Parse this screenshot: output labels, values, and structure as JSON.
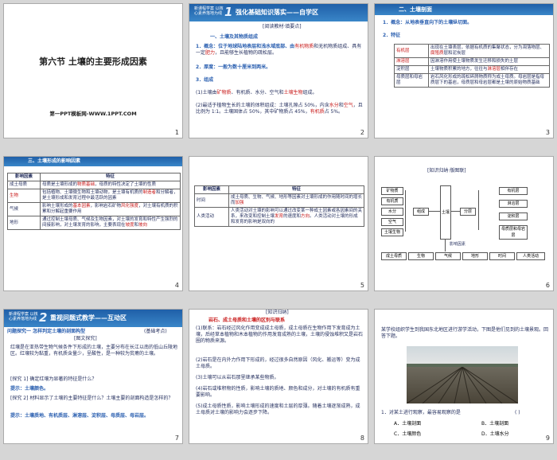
{
  "s1": {
    "title": "第六节  土壤的主要形成因素",
    "sub": "第一PPT模板网-WWW.1PPT.COM",
    "num": "1"
  },
  "s2": {
    "tag": "新课程学案 以核心素养落地为线",
    "big": "1",
    "title": "强化基础知识落实——自学区",
    "pink": "[阅读教材·填要点]",
    "h1": "一、土壤及其物质组成",
    "p1": "1．概念：位于地球陆地表层和浅水域底部、由",
    "p1a": "有机物质",
    "p1b": "和无机物质组成、具有一定",
    "p1c": "肥力",
    "p1d": "，且能够生长植物的疏松层。",
    "p2": "2．厚度：一般为数十厘米到两米。",
    "p3": "3．组成",
    "p4": "(1)土壤由",
    "p4a": "矿物质",
    "p4b": "、有机质、水分、空气和",
    "p4c": "土壤生物",
    "p4d": "组成。",
    "p5": "(2)最适于植物生长的土壤的体积组成：土壤孔隙占 50%，内含",
    "p5a": "水分",
    "p5b": "和",
    "p5c": "空气",
    "p5d": "，且比例为 1∶1。土壤固体占 50%，其中矿物质占 45%，",
    "p5e": "有机质",
    "p5f": "占 5%。",
    "num": "2"
  },
  "s3": {
    "title": "二、土壤剖面",
    "p1": "1．概念：从地表垂直向下的土壤纵切面。",
    "p2": "2．特征",
    "rows": [
      {
        "k": "有机层",
        "v": "出现在土壤表层，依据有机质的集聚状态，分为凋落物层、",
        "b": "腐殖质",
        "c": "层和泥炭层"
      },
      {
        "k": "淋溶层",
        "v": "因淋溶作用使土壤物质发生迁移和损失的土层",
        "b": "",
        "c": ""
      },
      {
        "k": "淀积层",
        "v": "土壤物质积累的地方，往往与",
        "b": "淋溶层",
        "c": "相伴存在"
      },
      {
        "k": "母质层和母岩层",
        "v": "岩石风化形成的疏松碎屑物质称为成土母质。",
        "b": "",
        "c": "母岩层是指母质层下的基岩，母质层和母岩层都是土壤的原始物质基础"
      }
    ],
    "num": "3"
  },
  "s4": {
    "title": "三、土壤形成的影响因素",
    "h1": "影响因素",
    "h2": "特征",
    "rows": [
      {
        "k": "成土母质",
        "a": "母质是土壤形成的",
        "b": "物质基础",
        "c": "，母质的特性决定了土壤的性质"
      },
      {
        "k": "生物",
        "a": "包括植物、土壤微生物和土壤动物，是土壤有机质的",
        "b": "制造者",
        "c": "和分解者，是土壤形成和发育过程中最活跃的因素"
      },
      {
        "k": "气候",
        "a": "影响土壤形成的",
        "b": "基本因素",
        "c": "，影响岩石矿物",
        "d": "风化强度",
        "e": "，对土壤有机质的积累和分解起重要作用"
      },
      {
        "k": "地形",
        "a": "通过控制土壤母质、气候及生物因素，对土壤的发育和特性产生强烈的间接影响，对土壤发育的影响，主要表现在",
        "b": "坡度",
        "c": "和",
        "d": "坡向",
        "e": ""
      }
    ],
    "num": "4"
  },
  "s5": {
    "h1": "影响因素",
    "h2": "特征",
    "r1k": "时间",
    "r1": "成土母质、生物、气候、地形等因素对土壤形成的作用随时间的增长而",
    "r1b": "加强",
    "r2k": "人类活动",
    "r2": "人类活动对土壤的影响可以通过改变某一种成土因素或各因素间的关系，来改变和控制土壤",
    "r2b": "发育",
    "r2c": "的速度和",
    "r2d": "方向",
    "r2e": "。人类活动对土壤的形成和发育的影响是双向的",
    "num": "5"
  },
  "s6": {
    "title": "[知识归纳·版图联]",
    "left": [
      "矿物质",
      "有机质",
      "水分",
      "空气",
      "土壤生物"
    ],
    "mid1": "组成",
    "center": "土壤",
    "mid2": "分层",
    "right": [
      "有机层",
      "淋溶层",
      "淀积层",
      "母质层和母岩层"
    ],
    "factor": "影响因素",
    "bottom": [
      "成土母质",
      "生物",
      "气候",
      "地形",
      "时间",
      "人类活动"
    ],
    "num": "6"
  },
  "s7": {
    "tag": "新课程学案 以核心素养落地为线",
    "big": "2",
    "title": "重视问题式教学——互动区",
    "q": "问题探究一  怎样判定土壤的剖面构型",
    "lvl": "(基础考点)",
    "pink": "[图文探究]",
    "p1": "红壤是在亚热带生物气候条件下形成的土壤，主要分布在长江以南的低山丘陵地区。红壤较为黏重，有机质含量少，呈酸性，是一种较为贫瘠的土壤。",
    "q1": "[探究 1]  确定红壤为显著的特征是什么？",
    "a1": "提示：土壤颜色。",
    "q2": "[探究 2]  材料显示了土壤的主要特征是什么？土壤主要的剖面构造是怎样的？",
    "a2": "提示：土壤质地、有机质层、淋溶层、淀积层、母质层、母岩层。",
    "num": "7"
  },
  "s8": {
    "title": "[知识归纳]",
    "h": "岩石、成土母质和土壤的区别与联系",
    "p1": "(1)联系：岩石经过风化作用变成成土母质，成土母质在生物作用下发育成为土壤，后经草本植物和木本植物的作用发育成熟的土壤，土壤的侵蚀堆积又是岩石圈的物质来源。",
    "p2": "(2)岩石是在内外力作用下形成的，经过很多自然原因（风化、搬运等）变为成土母质。",
    "p3": "(3)土壤可以从岩石那里继承某些物质。",
    "p4": "(4)岩石或堆积物的性质，影响土壤的质地、颜色和成分，对土壤的有机质有重要影响。",
    "p5": "(5)成土母质性质，影响土壤形成的速度和土层的厚薄。随着土壤逐渐成熟，成土母质对土壤的影响力会逐步下降。",
    "num": "8"
  },
  "s9": {
    "p1": "某学校组织学生到我国东北地区进行游学活动，下图是他们见到的土壤景观。回答下题。",
    "q": "1．对某土进行观察，最容易观察的是",
    "paren": "(     )",
    "a": "A．土壤剖面",
    "b": "B．土壤剖面",
    "c": "C．土壤颜色",
    "d": "D．土壤水分",
    "num": "9"
  }
}
